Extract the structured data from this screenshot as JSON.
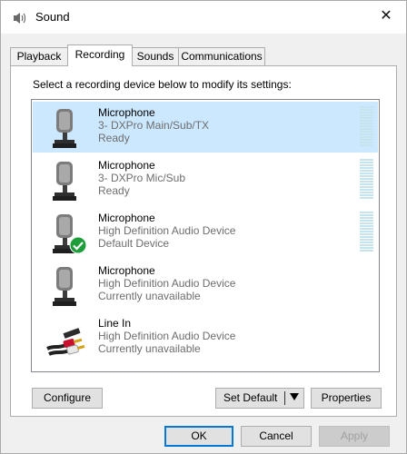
{
  "window": {
    "title": "Sound",
    "close_glyph": "✕"
  },
  "tabs": [
    {
      "label": "Playback"
    },
    {
      "label": "Recording"
    },
    {
      "label": "Sounds"
    },
    {
      "label": "Communications"
    }
  ],
  "active_tab": "Recording",
  "instruction": "Select a recording device below to modify its settings:",
  "devices": [
    {
      "name": "Microphone",
      "description": "3- DXPro Main/Sub/TX",
      "status": "Ready",
      "icon": "microphone-icon",
      "selected": true,
      "default": false
    },
    {
      "name": "Microphone",
      "description": "3- DXPro Mic/Sub",
      "status": "Ready",
      "icon": "microphone-icon",
      "selected": false,
      "default": false
    },
    {
      "name": "Microphone",
      "description": "High Definition Audio Device",
      "status": "Default Device",
      "icon": "microphone-icon",
      "selected": false,
      "default": true
    },
    {
      "name": "Microphone",
      "description": "High Definition Audio Device",
      "status": "Currently unavailable",
      "icon": "microphone-icon",
      "selected": false,
      "default": false
    },
    {
      "name": "Line In",
      "description": "High Definition Audio Device",
      "status": "Currently unavailable",
      "icon": "line-in-cable-icon",
      "selected": false,
      "default": false
    }
  ],
  "buttons": {
    "configure": "Configure",
    "set_default": "Set Default",
    "properties": "Properties",
    "ok": "OK",
    "cancel": "Cancel",
    "apply": "Apply"
  },
  "colors": {
    "selection": "#cce8ff",
    "default_badge": "#1e9e3a",
    "focus_border": "#0078d7",
    "meter_idle": "#c6e4ee"
  }
}
